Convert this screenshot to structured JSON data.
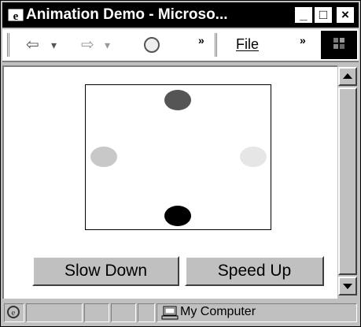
{
  "window": {
    "title": "Animation Demo - Microso...",
    "controls": {
      "minimize": "_",
      "maximize": "□",
      "close": "×"
    }
  },
  "toolbar": {
    "back_icon": "⇦",
    "dropdown": "▾",
    "forward_icon": "⇨",
    "more": "»",
    "file_menu": "File"
  },
  "animation": {
    "dots": [
      {
        "name": "dot-top",
        "color": "#555555"
      },
      {
        "name": "dot-left",
        "color": "#c8c8c8"
      },
      {
        "name": "dot-right",
        "color": "#e6e6e6"
      },
      {
        "name": "dot-bottom",
        "color": "#000000"
      }
    ]
  },
  "buttons": {
    "slow_down": "Slow Down",
    "speed_up": "Speed Up"
  },
  "status": {
    "zone": "My Computer"
  }
}
